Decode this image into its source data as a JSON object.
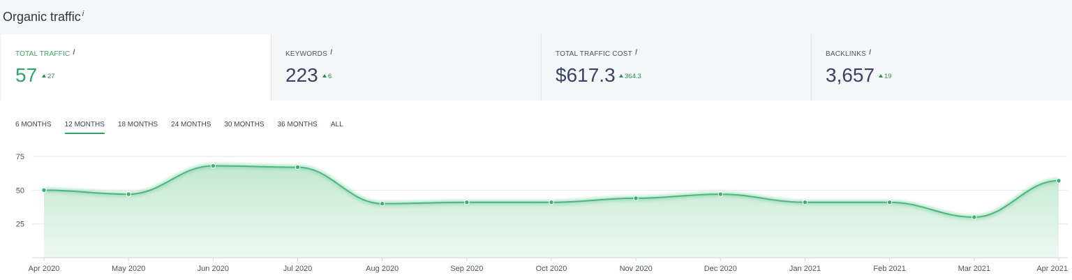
{
  "page": {
    "title": "Organic traffic",
    "title_info": "i"
  },
  "metrics": [
    {
      "label": "TOTAL TRAFFIC",
      "info": "i",
      "value": "57",
      "delta": "27"
    },
    {
      "label": "KEYWORDS",
      "info": "i",
      "value": "223",
      "delta": "6"
    },
    {
      "label": "TOTAL TRAFFIC COST",
      "info": "i",
      "value": "$617.3",
      "delta": "364.3"
    },
    {
      "label": "BACKLINKS",
      "info": "i",
      "value": "3,657",
      "delta": "19"
    }
  ],
  "tabs": [
    "6 MONTHS",
    "12 MONTHS",
    "18 MONTHS",
    "24 MONTHS",
    "30 MONTHS",
    "36 MONTHS",
    "ALL"
  ],
  "active_tab": "12 MONTHS",
  "colors": {
    "accent": "#2fa563",
    "line": "#4cb680",
    "fill": "#cfeedd",
    "value_text": "#3a4168"
  },
  "chart_data": {
    "type": "area",
    "categories": [
      "Apr 2020",
      "May 2020",
      "Jun 2020",
      "Jul 2020",
      "Aug 2020",
      "Sep 2020",
      "Oct 2020",
      "Nov 2020",
      "Dec 2020",
      "Jan 2021",
      "Feb 2021",
      "Mar 2021",
      "Apr 2021"
    ],
    "values": [
      50,
      47,
      68,
      67,
      40,
      41,
      41,
      44,
      47,
      41,
      41,
      30,
      57
    ],
    "y_ticks": [
      25,
      50,
      75
    ],
    "ylim": [
      0,
      75
    ],
    "grid": true
  }
}
